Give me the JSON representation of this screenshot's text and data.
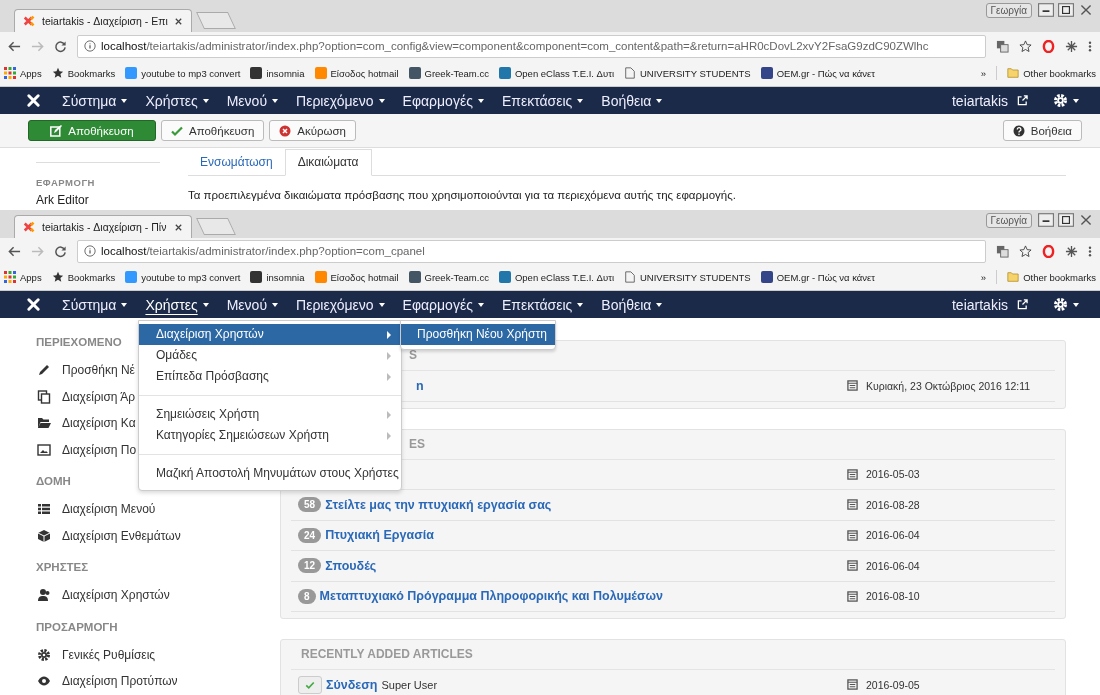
{
  "windows": [
    {
      "tab": {
        "title": "teiartakis - Διαχείριση - Επι"
      },
      "profile": "Γεωργία",
      "address": {
        "host": "localhost",
        "path": "/teiartakis/administrator/index.php?option=com_config&view=component&component=com_content&path=&return=aHR0cDovL2xvY2FsaG9zdC90ZWlhc"
      },
      "bookmarks": [
        "Apps",
        "Bookmarks",
        "youtube to mp3 convert",
        "insomnia",
        "Είσοδος hotmail",
        "Greek-Team.cc",
        "Open eClass T.E.I. Δυτι",
        "UNIVERSITY STUDENTS",
        "OEM.gr - Πώς να κάνετ"
      ],
      "more": "»",
      "other_bookmarks": "Other bookmarks",
      "nav": {
        "items": [
          {
            "label": "Σύστημα",
            "selected": false
          },
          {
            "label": "Χρήστες",
            "selected": false
          },
          {
            "label": "Μενού",
            "selected": false
          },
          {
            "label": "Περιεχόμενο",
            "selected": false
          },
          {
            "label": "Εφαρμογές",
            "selected": false
          },
          {
            "label": "Επεκτάσεις",
            "selected": false
          },
          {
            "label": "Βοήθεια",
            "selected": false
          }
        ],
        "user": "teiartakis"
      },
      "content": {
        "kind": "options",
        "toolbar": {
          "buttons": [
            {
              "label": "Αποθήκευση",
              "kind": "save"
            },
            {
              "label": "Αποθήκευση",
              "kind": "apply"
            },
            {
              "label": "Ακύρωση",
              "kind": "cancel"
            }
          ],
          "help": "Βοήθεια"
        },
        "sidebar": {
          "heading": "ΕΦΑΡΜΟΓΗ",
          "items": [
            "Ark Editor"
          ]
        },
        "tabs": [
          {
            "label": "Ενσωμάτωση",
            "selected": false
          },
          {
            "label": "Δικαιώματα",
            "selected": true
          }
        ],
        "description": "Τα προεπιλεγμένα δικαιώματα πρόσβασης που χρησιμοποιούνται για τα περιεχόμενα αυτής της εφαρμογής."
      }
    },
    {
      "tab": {
        "title": "teiartakis - Διαχείριση - Πίν"
      },
      "profile": "Γεωργία",
      "address": {
        "host": "localhost",
        "path": "/teiartakis/administrator/index.php?option=com_cpanel"
      },
      "bookmarks": [
        "Apps",
        "Bookmarks",
        "youtube to mp3 convert",
        "insomnia",
        "Είσοδος hotmail",
        "Greek-Team.cc",
        "Open eClass T.E.I. Δυτι",
        "UNIVERSITY STUDENTS",
        "OEM.gr - Πώς να κάνετ"
      ],
      "more": "»",
      "other_bookmarks": "Other bookmarks",
      "nav": {
        "items": [
          {
            "label": "Σύστημα",
            "selected": false
          },
          {
            "label": "Χρήστες",
            "selected": true
          },
          {
            "label": "Μενού",
            "selected": false
          },
          {
            "label": "Περιεχόμενο",
            "selected": false
          },
          {
            "label": "Εφαρμογές",
            "selected": false
          },
          {
            "label": "Επεκτάσεις",
            "selected": false
          },
          {
            "label": "Βοήθεια",
            "selected": false
          }
        ],
        "user": "teiartakis"
      },
      "content": {
        "kind": "cpanel",
        "sidebar": [
          {
            "heading": "ΠΕΡΙΕΧΟΜΕΝΟ",
            "items": [
              "Προσθήκη Νέ",
              "Διαχείριση Άρ",
              "Διαχείριση Κα",
              "Διαχείριση Πο"
            ]
          },
          {
            "heading": "ΔΟΜΗ",
            "items": [
              "Διαχείριση Μενού",
              "Διαχείριση Ενθεμάτων"
            ]
          },
          {
            "heading": "ΧΡΗΣΤΕΣ",
            "items": [
              "Διαχείριση Χρηστών"
            ]
          },
          {
            "heading": "ΠΡΟΣΑΡΜΟΓΗ",
            "items": [
              "Γενικές Ρυθμίσεις",
              "Διαχείριση Προτύπων"
            ]
          }
        ],
        "panels": [
          {
            "heading": "S",
            "rows": [
              {
                "title": "n",
                "date": "Κυριακή, 23 Οκτώβριος 2016 12:11"
              }
            ]
          },
          {
            "heading": "ES",
            "rows": [
              {
                "date": "2016-05-03"
              },
              {
                "count": "58",
                "title": "Στείλτε μας την πτυχιακή εργασία σας",
                "date": "2016-08-28"
              },
              {
                "count": "24",
                "title": "Πτυχιακή Εργασία",
                "date": "2016-06-04"
              },
              {
                "count": "12",
                "title": "Σπουδές",
                "date": "2016-06-04"
              },
              {
                "count": "8",
                "title": "Μεταπτυχιακό Πρόγραμμα Πληροφορικής και Πολυμέσων",
                "date": "2016-08-10"
              }
            ]
          },
          {
            "heading": "RECENTLY ADDED ARTICLES",
            "rows": [
              {
                "published": true,
                "title": "Σύνδεση",
                "author": "Super User",
                "date": "2016-09-05"
              }
            ]
          }
        ],
        "menu": {
          "groups": [
            [
              {
                "label": "Διαχείριση Χρηστών",
                "submenu": true,
                "selected": true
              },
              {
                "label": "Ομάδες",
                "submenu": true,
                "selected": false
              },
              {
                "label": "Επίπεδα Πρόσβασης",
                "submenu": true,
                "selected": false
              }
            ],
            [
              {
                "label": "Σημειώσεις Χρήστη",
                "submenu": true,
                "selected": false
              },
              {
                "label": "Κατηγορίες Σημειώσεων Χρήστη",
                "submenu": true,
                "selected": false
              }
            ],
            [
              {
                "label": "Μαζική Αποστολή Μηνυμάτων στους Χρήστες",
                "submenu": false,
                "selected": false
              }
            ]
          ],
          "submenu": [
            {
              "label": "Προσθήκη Νέου Χρήστη",
              "selected": true
            }
          ]
        }
      }
    }
  ]
}
